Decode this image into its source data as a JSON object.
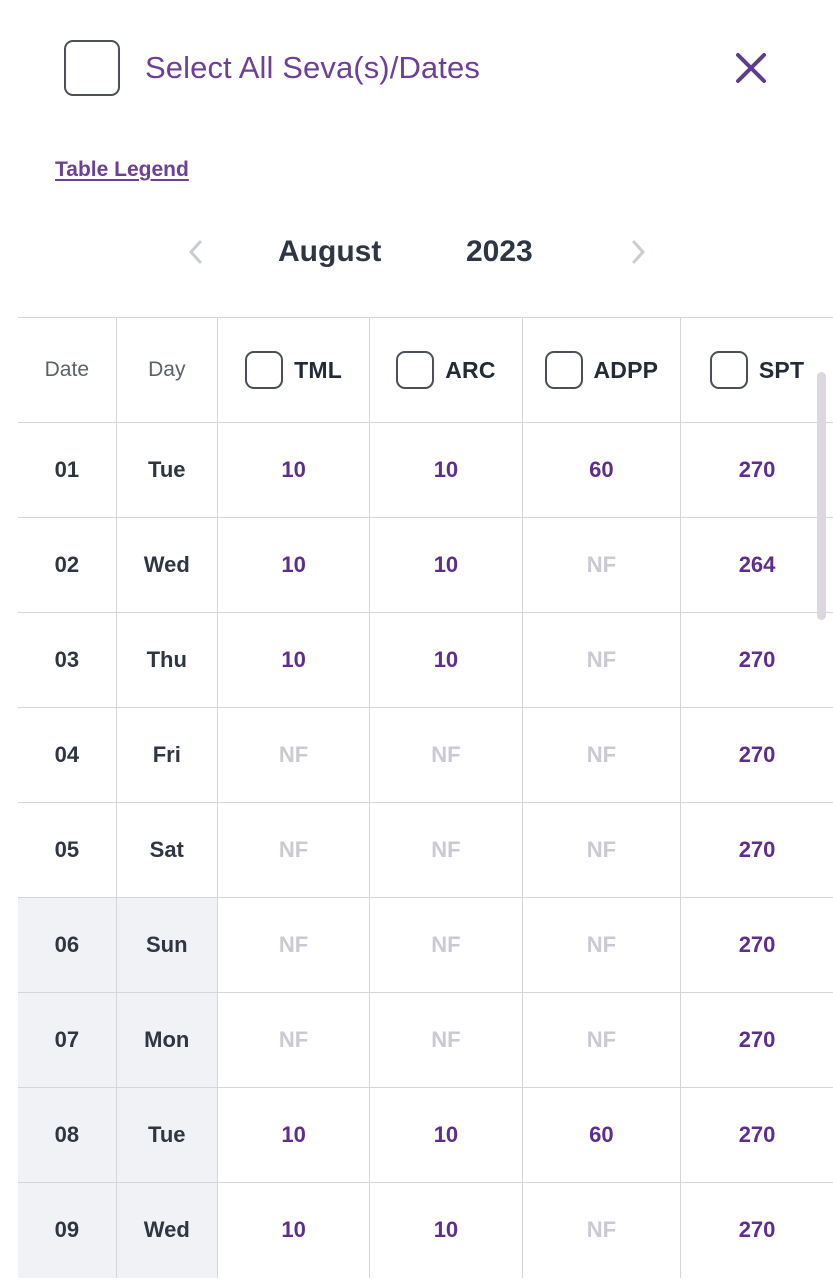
{
  "header": {
    "select_all_label": "Select All Seva(s)/Dates",
    "close_icon": "close-icon"
  },
  "legend": {
    "link_label": "Table Legend"
  },
  "month_nav": {
    "prev_icon": "chevron-left-icon",
    "next_icon": "chevron-right-icon",
    "month": "August",
    "year": "2023"
  },
  "table": {
    "columns": [
      {
        "key": "date",
        "label": "Date",
        "checkbox": false
      },
      {
        "key": "day",
        "label": "Day",
        "checkbox": false
      },
      {
        "key": "tml",
        "label": "TML",
        "checkbox": true
      },
      {
        "key": "arc",
        "label": "ARC",
        "checkbox": true
      },
      {
        "key": "adpp",
        "label": "ADPP",
        "checkbox": true
      },
      {
        "key": "spt",
        "label": "SPT",
        "checkbox": true
      }
    ],
    "rows": [
      {
        "date": "01",
        "day": "Tue",
        "tml": "10",
        "arc": "10",
        "adpp": "60",
        "spt": "270",
        "highlight": false
      },
      {
        "date": "02",
        "day": "Wed",
        "tml": "10",
        "arc": "10",
        "adpp": "NF",
        "spt": "264",
        "highlight": false
      },
      {
        "date": "03",
        "day": "Thu",
        "tml": "10",
        "arc": "10",
        "adpp": "NF",
        "spt": "270",
        "highlight": false
      },
      {
        "date": "04",
        "day": "Fri",
        "tml": "NF",
        "arc": "NF",
        "adpp": "NF",
        "spt": "270",
        "highlight": false
      },
      {
        "date": "05",
        "day": "Sat",
        "tml": "NF",
        "arc": "NF",
        "adpp": "NF",
        "spt": "270",
        "highlight": false
      },
      {
        "date": "06",
        "day": "Sun",
        "tml": "NF",
        "arc": "NF",
        "adpp": "NF",
        "spt": "270",
        "highlight": true
      },
      {
        "date": "07",
        "day": "Mon",
        "tml": "NF",
        "arc": "NF",
        "adpp": "NF",
        "spt": "270",
        "highlight": true
      },
      {
        "date": "08",
        "day": "Tue",
        "tml": "10",
        "arc": "10",
        "adpp": "60",
        "spt": "270",
        "highlight": true
      },
      {
        "date": "09",
        "day": "Wed",
        "tml": "10",
        "arc": "10",
        "adpp": "NF",
        "spt": "270",
        "highlight": true
      }
    ],
    "not_available_code": "NF"
  },
  "colors": {
    "accent_purple": "#6d4096",
    "value_purple": "#5e2d8e",
    "dark_slate": "#2d3642",
    "muted_gray": "#5b6169",
    "nf_gray": "#cbc9d4",
    "border_gray": "#d4d6d9",
    "row_highlight": "#f1f2f5",
    "scrollbar_thumb": "#ddd8e0"
  }
}
